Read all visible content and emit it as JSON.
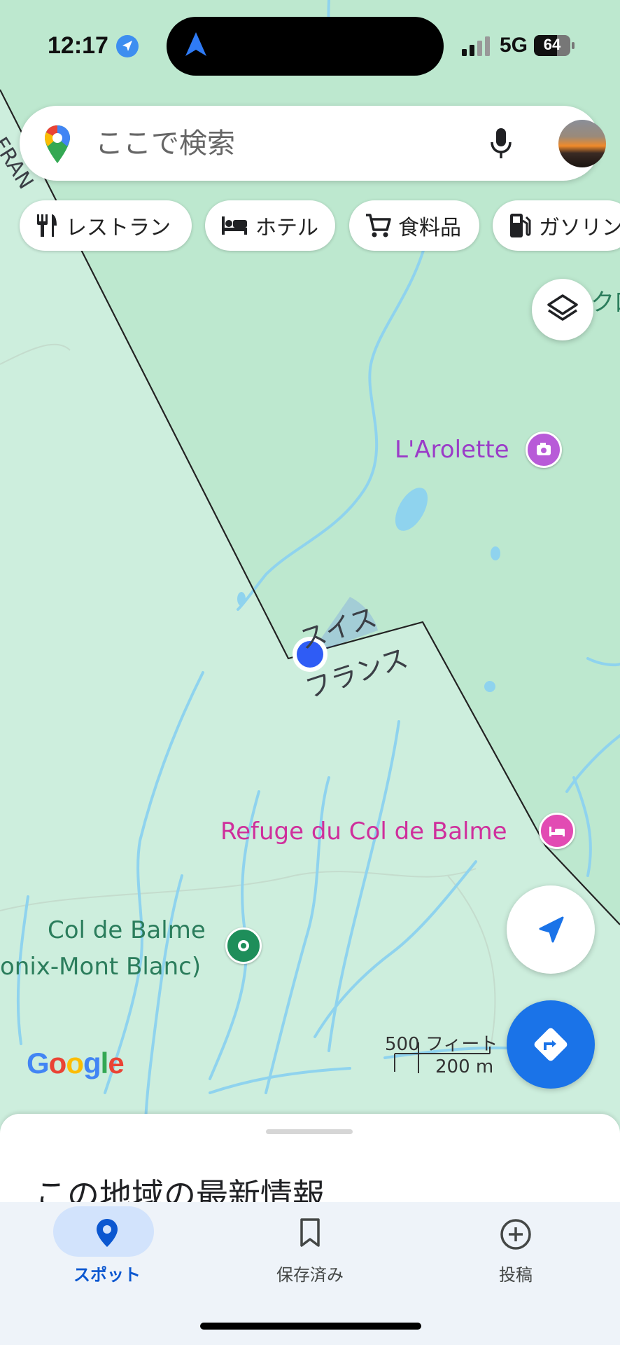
{
  "status_bar": {
    "time": "12:17",
    "network": "5G",
    "battery": "64",
    "battery_level_percent": 64,
    "icons": [
      "location-arrow-icon",
      "navigation-icon",
      "signal-icon",
      "battery-icon"
    ]
  },
  "search": {
    "placeholder": "ここで検索",
    "icons": [
      "maps-pin-icon",
      "microphone-icon"
    ]
  },
  "chips": [
    {
      "label": "レストラン",
      "icon": "restaurant-icon"
    },
    {
      "label": "ホテル",
      "icon": "hotel-icon"
    },
    {
      "label": "食料品",
      "icon": "cart-icon"
    },
    {
      "label": "ガソリン",
      "icon": "gas-pump-icon"
    }
  ],
  "map": {
    "places": {
      "arolette": "L'Arolette",
      "refuge": "Refuge du Col de Balme",
      "col_line1": "Col de Balme",
      "col_line2": "onix-Mont Blanc)",
      "edge_label": "ク口"
    },
    "border": {
      "north": "スイス",
      "south": "フランス",
      "west_edge": "FRAN"
    },
    "scale": {
      "imperial": "500 フィート",
      "metric": "200 m"
    },
    "brand": "Google",
    "colors": {
      "land": "#cdeedd",
      "swiss_area": "#bde8cf",
      "water": "#8fd3ee",
      "accent": "#1a73e8",
      "location_dot": "#2f5cf5"
    }
  },
  "sheet": {
    "title": "この地域の最新情報"
  },
  "nav": {
    "items": [
      {
        "label": "スポット",
        "icon": "place-pin-icon",
        "active": true
      },
      {
        "label": "保存済み",
        "icon": "bookmark-icon",
        "active": false
      },
      {
        "label": "投稿",
        "icon": "add-circle-icon",
        "active": false
      }
    ]
  }
}
